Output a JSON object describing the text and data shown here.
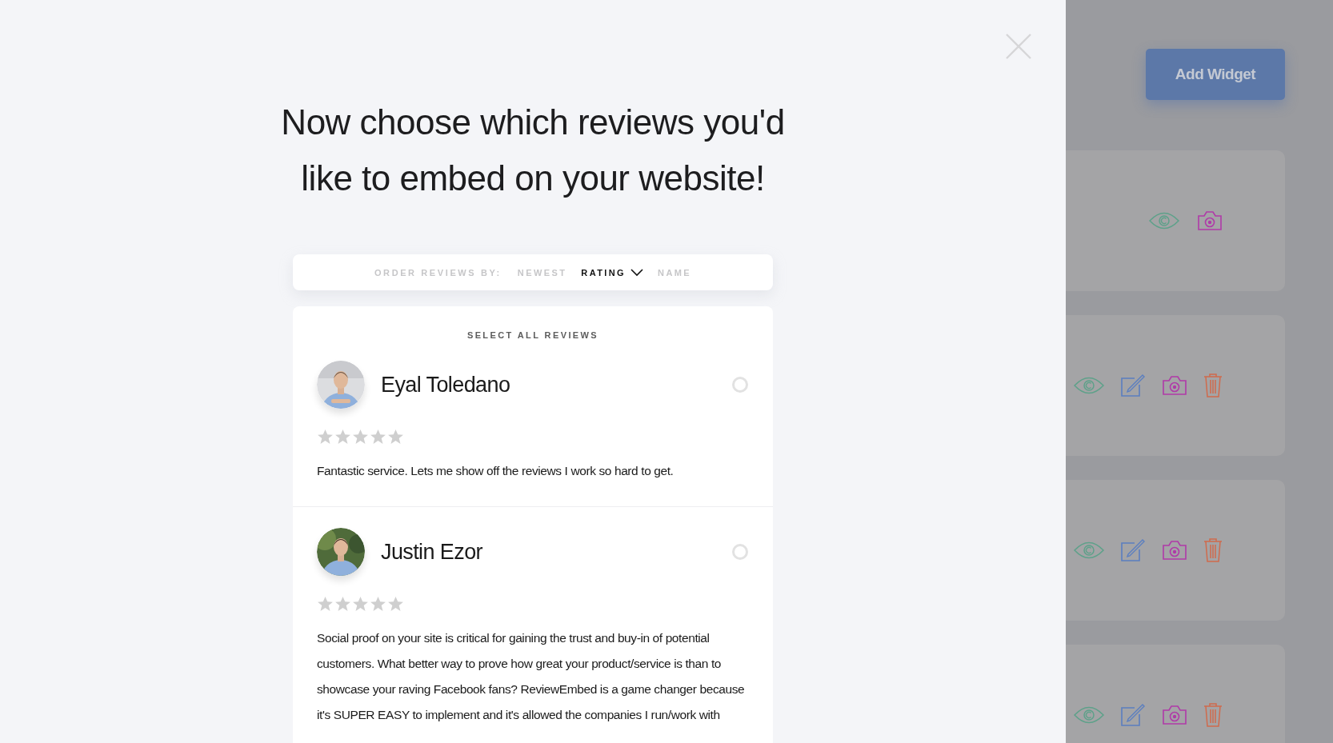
{
  "modal": {
    "title": "Now choose which reviews you'd like to embed on your website!",
    "sort": {
      "label": "ORDER REVIEWS BY:",
      "options": [
        {
          "label": "NEWEST",
          "selected": false
        },
        {
          "label": "RATING",
          "selected": true
        },
        {
          "label": "NAME",
          "selected": false
        }
      ]
    },
    "select_all": "SELECT ALL REVIEWS",
    "reviews": [
      {
        "name": "Eyal Toledano",
        "selected": false,
        "stars": 0,
        "text": "Fantastic service. Lets me show off the reviews I work so hard to get."
      },
      {
        "name": "Justin Ezor",
        "selected": false,
        "stars": 0,
        "text": "Social proof on your site is critical for gaining the trust and buy-in of potential customers. What better way to prove how great your product/service is than to showcase your raving Facebook fans? ReviewEmbed is a game changer because it's SUPER EASY to implement and it's allowed the companies I run/work with"
      }
    ]
  },
  "background": {
    "add_button": "Add Widget",
    "widgets": [
      {
        "actions": [
          {
            "kind": "view"
          },
          {
            "kind": "snapshot"
          }
        ]
      },
      {
        "actions": [
          {
            "kind": "view"
          },
          {
            "kind": "edit"
          },
          {
            "kind": "snapshot"
          },
          {
            "kind": "delete"
          }
        ]
      },
      {
        "actions": [
          {
            "kind": "view"
          },
          {
            "kind": "edit"
          },
          {
            "kind": "snapshot"
          },
          {
            "kind": "delete"
          }
        ]
      },
      {
        "actions": [
          {
            "kind": "view"
          },
          {
            "kind": "edit"
          },
          {
            "kind": "snapshot"
          },
          {
            "kind": "delete"
          }
        ]
      }
    ]
  }
}
